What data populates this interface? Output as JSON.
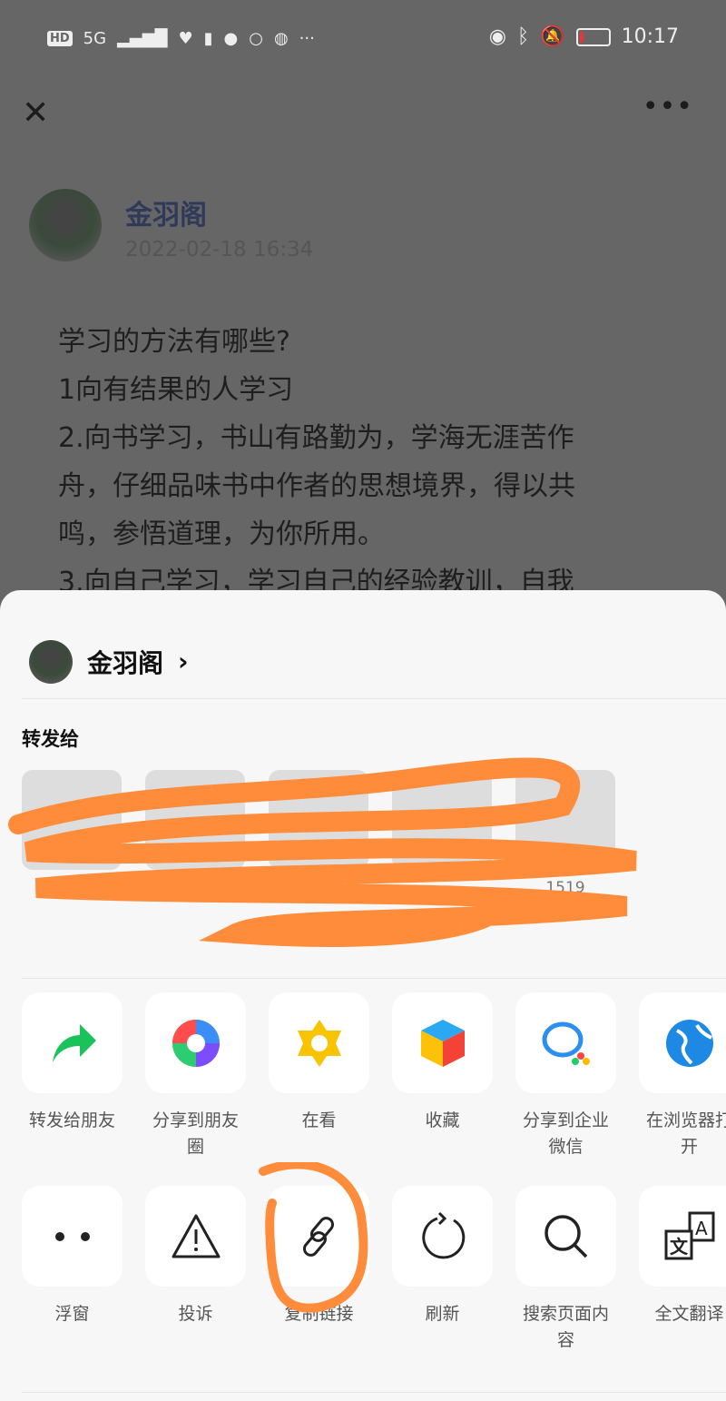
{
  "status_bar": {
    "time": "10:17",
    "network": "5G",
    "more": "···"
  },
  "top_bar": {
    "close": "✕",
    "more": "•••"
  },
  "post": {
    "author": "金羽阁",
    "date": "2022-02-18 16:34",
    "lines": [
      "学习的方法有哪些?",
      "1向有结果的人学习",
      "2.向书学习，书山有路勤为，学海无涯苦作",
      "舟，仔细品味书中作者的思想境界，得以共",
      "鸣，参悟道理，为你所用。",
      "3.向自己学习，学习自己的经验教训，自我"
    ]
  },
  "sheet": {
    "account_name": "金羽阁",
    "chevron": "›",
    "forward_to": "转发给",
    "contact_visible_fragment": "1519 0352772",
    "row1": [
      {
        "label": "转发给朋友",
        "icon": "forward-arrow-icon"
      },
      {
        "label": "分享到朋友圈",
        "icon": "moments-icon"
      },
      {
        "label": "在看",
        "icon": "wow-icon"
      },
      {
        "label": "收藏",
        "icon": "favorites-cube-icon"
      },
      {
        "label": "分享到企业微信",
        "icon": "wecom-icon"
      },
      {
        "label": "在浏览器打开",
        "icon": "browser-globe-icon"
      }
    ],
    "row2": [
      {
        "label": "浮窗",
        "icon": "float-window-icon"
      },
      {
        "label": "投诉",
        "icon": "warning-icon"
      },
      {
        "label": "复制链接",
        "icon": "link-icon"
      },
      {
        "label": "刷新",
        "icon": "refresh-icon"
      },
      {
        "label": "搜索页面内容",
        "icon": "search-icon"
      },
      {
        "label": "全文翻译",
        "icon": "translate-icon"
      }
    ]
  },
  "colors": {
    "annotation": "#ff8c3a",
    "dim": "#666666",
    "sheet_bg": "#f7f7f7"
  }
}
